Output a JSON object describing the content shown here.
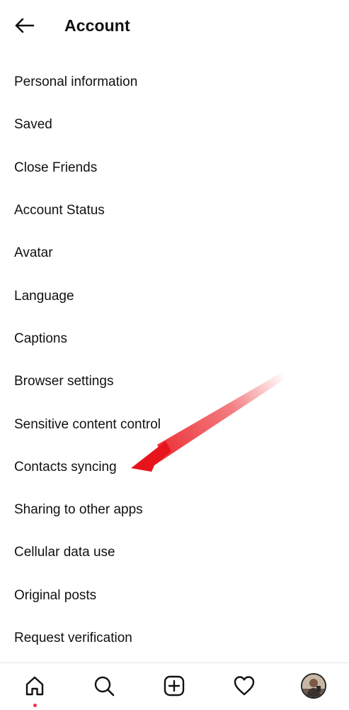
{
  "header": {
    "title": "Account",
    "back_icon": "arrow-left-icon"
  },
  "menu": {
    "items": [
      {
        "label": "Personal information"
      },
      {
        "label": "Saved"
      },
      {
        "label": "Close Friends"
      },
      {
        "label": "Account Status"
      },
      {
        "label": "Avatar"
      },
      {
        "label": "Language"
      },
      {
        "label": "Captions"
      },
      {
        "label": "Browser settings"
      },
      {
        "label": "Sensitive content control"
      },
      {
        "label": "Contacts syncing"
      },
      {
        "label": "Sharing to other apps"
      },
      {
        "label": "Cellular data use"
      },
      {
        "label": "Original posts"
      },
      {
        "label": "Request verification"
      }
    ]
  },
  "annotation": {
    "type": "arrow",
    "color": "#e8141b",
    "points_to": "Contacts syncing"
  },
  "bottom_nav": {
    "items": [
      {
        "icon": "home-icon",
        "active": true,
        "notification_dot_color": "#ff2b4f"
      },
      {
        "icon": "search-icon"
      },
      {
        "icon": "create-post-icon"
      },
      {
        "icon": "heart-icon"
      },
      {
        "icon": "profile-avatar-icon"
      }
    ]
  }
}
